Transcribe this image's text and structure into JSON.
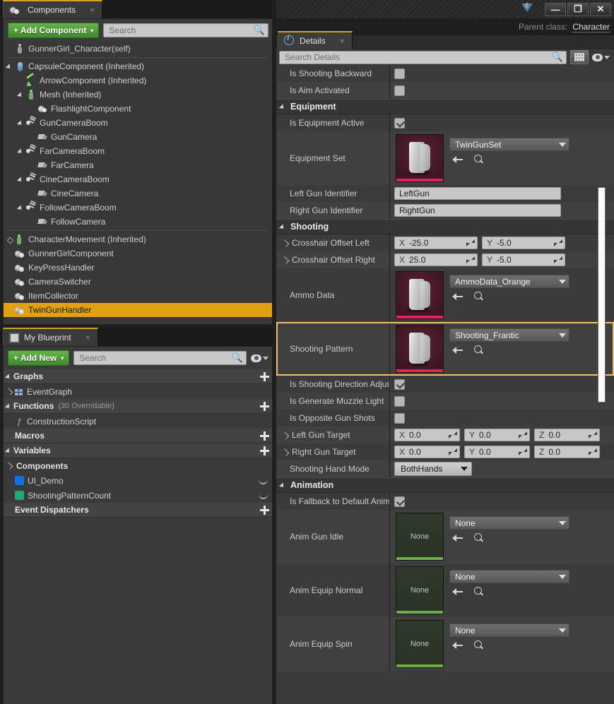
{
  "window": {
    "minimize_label": "—",
    "restore_label": "❐",
    "close_label": "✕",
    "logo_icon": "unreal-engine-logo-icon",
    "parent_class_label": "Parent class:",
    "parent_class_value": "Character"
  },
  "components_panel": {
    "tab_title": "Components",
    "tab_icon": "components-icon",
    "close_icon": "×",
    "add_component_label": "+ Add Component",
    "add_component_caret": "▾",
    "search_placeholder": "Search",
    "search_icon": "search-icon",
    "tree": [
      {
        "label": "GunnerGirl_Character(self)",
        "indent": 0,
        "arrow": "none",
        "icon": "person-icon",
        "selected": false
      },
      {
        "label": "CapsuleComponent (Inherited)",
        "indent": 0,
        "arrow": "down",
        "icon": "capsule-icon",
        "selected": false
      },
      {
        "label": "ArrowComponent (Inherited)",
        "indent": 1,
        "arrow": "none",
        "icon": "arrow-component-icon",
        "selected": false
      },
      {
        "label": "Mesh (Inherited)",
        "indent": 1,
        "arrow": "down",
        "icon": "mesh-icon",
        "selected": false
      },
      {
        "label": "FlashlightComponent",
        "indent": 2,
        "arrow": "none",
        "icon": "sphere-icon",
        "selected": false
      },
      {
        "label": "GunCameraBoom",
        "indent": 1,
        "arrow": "down",
        "icon": "spring-arm-icon",
        "selected": false
      },
      {
        "label": "GunCamera",
        "indent": 2,
        "arrow": "none",
        "icon": "camera-icon",
        "selected": false
      },
      {
        "label": "FarCameraBoom",
        "indent": 1,
        "arrow": "down",
        "icon": "spring-arm-icon",
        "selected": false
      },
      {
        "label": "FarCamera",
        "indent": 2,
        "arrow": "none",
        "icon": "camera-icon",
        "selected": false
      },
      {
        "label": "CineCameraBoom",
        "indent": 1,
        "arrow": "down",
        "icon": "spring-arm-icon",
        "selected": false
      },
      {
        "label": "CineCamera",
        "indent": 2,
        "arrow": "none",
        "icon": "camera-icon",
        "selected": false
      },
      {
        "label": "FollowCameraBoom",
        "indent": 1,
        "arrow": "down",
        "icon": "spring-arm-icon",
        "selected": false
      },
      {
        "label": "FollowCamera",
        "indent": 2,
        "arrow": "none",
        "icon": "camera-icon",
        "selected": false
      },
      {
        "label": "CharacterMovement (Inherited)",
        "indent": 0,
        "arrow": "dot",
        "icon": "character-movement-icon",
        "selected": false
      },
      {
        "label": "GunnerGirlComponent",
        "indent": 0,
        "arrow": "none",
        "icon": "actor-component-icon",
        "selected": false
      },
      {
        "label": "KeyPressHandler",
        "indent": 0,
        "arrow": "none",
        "icon": "actor-component-icon",
        "selected": false
      },
      {
        "label": "CameraSwitcher",
        "indent": 0,
        "arrow": "none",
        "icon": "actor-component-icon",
        "selected": false
      },
      {
        "label": "ItemCollector",
        "indent": 0,
        "arrow": "none",
        "icon": "actor-component-icon",
        "selected": false
      },
      {
        "label": "TwinGunHandler",
        "indent": 0,
        "arrow": "none",
        "icon": "actor-component-icon",
        "selected": true
      }
    ],
    "selection_color": "#e0a212"
  },
  "my_blueprint_panel": {
    "tab_title": "My Blueprint",
    "tab_icon": "blueprint-book-icon",
    "close_icon": "×",
    "add_new_label": "+ Add New",
    "add_new_caret": "▾",
    "search_placeholder": "Search",
    "search_icon": "search-icon",
    "eye_icon": "eye-icon",
    "sections": [
      {
        "title": "Graphs",
        "subtitle": "",
        "collapsible": true,
        "plus": "+",
        "items": [
          {
            "label": "EventGraph",
            "icon": "event-graph-icon",
            "arrow": "right"
          }
        ]
      },
      {
        "title": "Functions",
        "subtitle": "(30 Overridable)",
        "collapsible": true,
        "plus": "+",
        "items": [
          {
            "label": "ConstructionScript",
            "icon": "function-icon",
            "arrow": "none"
          }
        ]
      },
      {
        "title": "Macros",
        "subtitle": "",
        "collapsible": false,
        "plus": "+",
        "items": []
      },
      {
        "title": "Variables",
        "subtitle": "",
        "collapsible": true,
        "plus": "+",
        "items": [
          {
            "label": "Components",
            "icon": "category-icon",
            "arrow": "right"
          },
          {
            "label": "UI_Demo",
            "icon": "object-var-icon",
            "arrow": "none",
            "swatch": "#0b74e0",
            "curve": true
          },
          {
            "label": "ShootingPatternCount",
            "icon": "int-var-icon",
            "arrow": "none",
            "swatch": "#1aab78",
            "curve": true
          }
        ]
      },
      {
        "title": "Event Dispatchers",
        "subtitle": "",
        "collapsible": false,
        "plus": "+",
        "items": []
      }
    ]
  },
  "details_panel": {
    "tab_title": "Details",
    "tab_icon": "details-info-icon",
    "close_icon": "×",
    "search_placeholder": "Search Details",
    "search_icon": "search-icon",
    "grid_button_icon": "grid-view-icon",
    "eye_icon": "eye-icon",
    "caret_icon": "chevron-down-icon",
    "top_rows": [
      {
        "label": "Is Shooting Backward",
        "type": "checkbox",
        "checked": false
      },
      {
        "label": "Is Aim Activated",
        "type": "checkbox",
        "checked": false
      }
    ],
    "sections": [
      {
        "title": "Equipment",
        "rows": [
          {
            "label": "Is Equipment Active",
            "type": "checkbox",
            "checked": true
          },
          {
            "label": "Equipment Set",
            "type": "asset",
            "value": "TwinGunSet",
            "thumb": "gun-asset-thumbnail",
            "thumb_kind": "data"
          },
          {
            "label": "Left Gun Identifier",
            "type": "text",
            "value": "LeftGun"
          },
          {
            "label": "Right Gun Identifier",
            "type": "text",
            "value": "RightGun"
          }
        ]
      },
      {
        "title": "Shooting",
        "rows": [
          {
            "label": "Crosshair Offset Left",
            "type": "vector2",
            "expandable": true,
            "x": "-25.0",
            "y": "-5.0"
          },
          {
            "label": "Crosshair Offset Right",
            "type": "vector2",
            "expandable": true,
            "x": "25.0",
            "y": "-5.0"
          },
          {
            "label": "Ammo Data",
            "type": "asset",
            "value": "AmmoData_Orange",
            "thumb": "gun-asset-thumbnail",
            "thumb_kind": "data"
          },
          {
            "label": "Shooting Pattern",
            "type": "asset",
            "value": "Shooting_Frantic",
            "thumb": "gun-asset-thumbnail",
            "thumb_kind": "data",
            "highlighted": true
          },
          {
            "label": "Is Shooting Direction Adjust",
            "type": "checkbox",
            "checked": true
          },
          {
            "label": "Is Generate Muzzle Light",
            "type": "checkbox",
            "checked": false
          },
          {
            "label": "Is Opposite Gun Shots",
            "type": "checkbox",
            "checked": false
          },
          {
            "label": "Left Gun Target",
            "type": "vector3",
            "expandable": true,
            "x": "0.0",
            "y": "0.0",
            "z": "0.0"
          },
          {
            "label": "Right Gun Target",
            "type": "vector3",
            "expandable": true,
            "x": "0.0",
            "y": "0.0",
            "z": "0.0"
          },
          {
            "label": "Shooting Hand Mode",
            "type": "enum",
            "value": "BothHands"
          }
        ]
      },
      {
        "title": "Animation",
        "rows": [
          {
            "label": "Is Fallback to Default Anima",
            "type": "checkbox",
            "checked": true
          },
          {
            "label": "Anim Gun Idle",
            "type": "asset",
            "value": "None",
            "thumb": "none-anim-thumbnail",
            "thumb_kind": "anim",
            "thumb_text": "None"
          },
          {
            "label": "Anim Equip Normal",
            "type": "asset",
            "value": "None",
            "thumb": "none-anim-thumbnail",
            "thumb_kind": "anim",
            "thumb_text": "None"
          },
          {
            "label": "Anim Equip Spin",
            "type": "asset",
            "value": "None",
            "thumb": "none-anim-thumbnail",
            "thumb_kind": "anim",
            "thumb_text": "None"
          }
        ]
      }
    ],
    "axis_labels": {
      "x": "X",
      "y": "Y",
      "z": "Z"
    },
    "highlight_color": "#f0c070",
    "scrollbar": {
      "visible": true
    }
  }
}
